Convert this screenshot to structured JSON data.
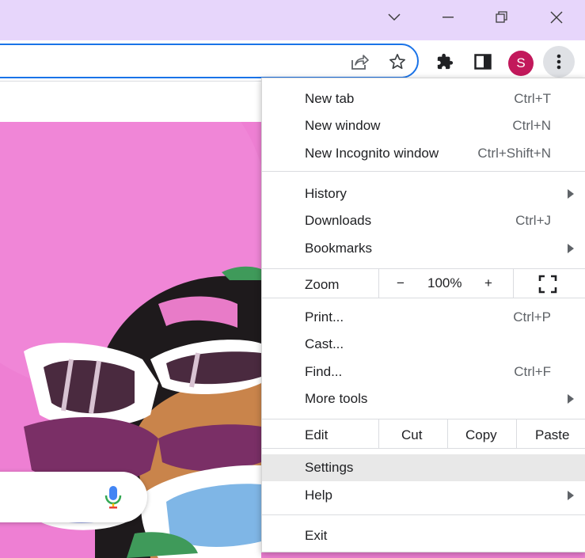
{
  "titlebar": {
    "icons": [
      "chevron-down-icon",
      "minimize-icon",
      "restore-icon",
      "close-icon"
    ],
    "bg_color": "#e7d6fb"
  },
  "toolbar": {
    "icons": [
      "share-icon",
      "bookmark-star-icon",
      "extensions-puzzle-icon",
      "side-panel-icon",
      "more-vert-icon"
    ],
    "profile_initial": "S",
    "profile_color": "#c2185b",
    "omnibox_focus_color": "#1a73e8"
  },
  "menu": {
    "new_tab": {
      "label": "New tab",
      "shortcut": "Ctrl+T"
    },
    "new_window": {
      "label": "New window",
      "shortcut": "Ctrl+N"
    },
    "new_incognito": {
      "label": "New Incognito window",
      "shortcut": "Ctrl+Shift+N"
    },
    "history": {
      "label": "History"
    },
    "downloads": {
      "label": "Downloads",
      "shortcut": "Ctrl+J"
    },
    "bookmarks": {
      "label": "Bookmarks"
    },
    "zoom": {
      "label": "Zoom",
      "minus": "−",
      "value": "100%",
      "plus": "+"
    },
    "print": {
      "label": "Print...",
      "shortcut": "Ctrl+P"
    },
    "cast": {
      "label": "Cast..."
    },
    "find": {
      "label": "Find...",
      "shortcut": "Ctrl+F"
    },
    "more_tools": {
      "label": "More tools"
    },
    "edit": {
      "label": "Edit",
      "cut": "Cut",
      "copy": "Copy",
      "paste": "Paste"
    },
    "settings": {
      "label": "Settings"
    },
    "help": {
      "label": "Help"
    },
    "exit": {
      "label": "Exit"
    }
  },
  "page": {
    "doodle_bg_color": "#ee7fd3",
    "mic_icon": "microphone-icon"
  }
}
